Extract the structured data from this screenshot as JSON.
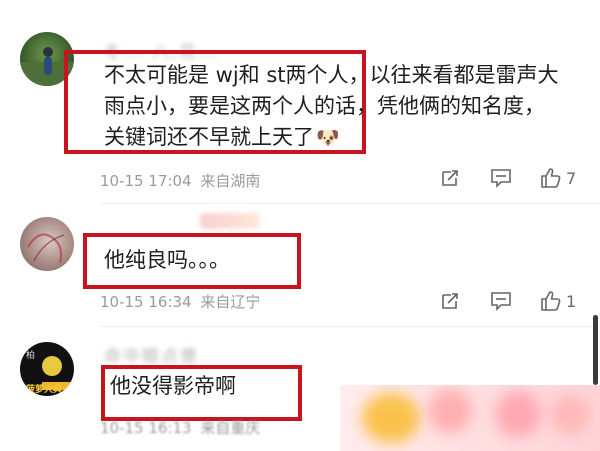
{
  "comments": [
    {
      "username": "冬... 八,花...",
      "text_line1": "不太可能是 wj和 st两个人，以往来看都是雷声大",
      "text_line2": "雨点小，要是这两个人的话，凭他俩的知名度，",
      "text_line3": "关键词还不早就上天了",
      "emoji": "🐶",
      "date": "10-15 17:04",
      "location": "来自湖南",
      "likes": "7"
    },
    {
      "username": "",
      "text": "他纯良吗。。。",
      "date": "10-15 16:34",
      "location": "来自辽宁",
      "likes": "1"
    },
    {
      "username": "命中眼点傻",
      "avatar_text_top": "柏",
      "avatar_text_bottom": "菠萝大典",
      "text": "他没得影帝啊",
      "date": "10-15 16:13",
      "location": "来自重庆"
    }
  ],
  "icons": {
    "share": "share-icon",
    "comment": "comment-icon",
    "like": "thumbs-up-icon"
  },
  "colors": {
    "highlight_box": "#c8141e",
    "meta_text": "#9a9a9a",
    "body_text": "#1e1e1e"
  }
}
